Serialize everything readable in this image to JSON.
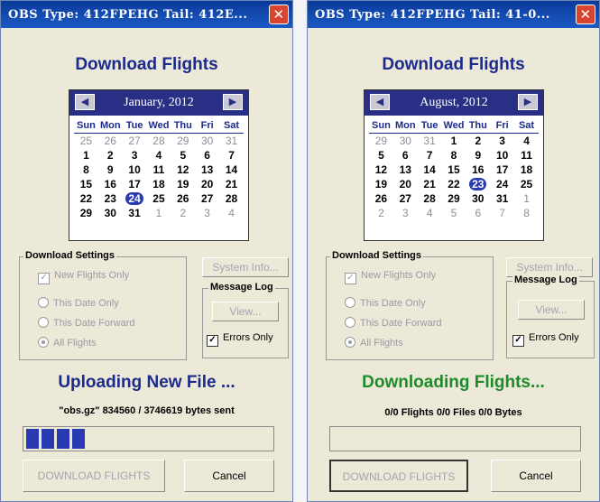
{
  "days_of_week": [
    "Sun",
    "Mon",
    "Tue",
    "Wed",
    "Thu",
    "Fri",
    "Sat"
  ],
  "left": {
    "title": "OBS    Type: 412FPEHG    Tail: 412E...",
    "heading": "Download Flights",
    "calendar": {
      "month_label": "January, 2012",
      "prev_icon": "◀",
      "next_icon": "▶",
      "weeks": [
        [
          "25",
          "26",
          "27",
          "28",
          "29",
          "30",
          "31"
        ],
        [
          "1",
          "2",
          "3",
          "4",
          "5",
          "6",
          "7"
        ],
        [
          "8",
          "9",
          "10",
          "11",
          "12",
          "13",
          "14"
        ],
        [
          "15",
          "16",
          "17",
          "18",
          "19",
          "20",
          "21"
        ],
        [
          "22",
          "23",
          "24",
          "25",
          "26",
          "27",
          "28"
        ],
        [
          "29",
          "30",
          "31",
          "1",
          "2",
          "3",
          "4"
        ]
      ]
    },
    "download_settings_label": "Download Settings",
    "new_flights_only": "New Flights Only",
    "this_date_only": "This Date Only",
    "this_date_forward": "This Date Forward",
    "all_flights": "All Flights",
    "system_info": "System Info...",
    "message_log_label": "Message Log",
    "view": "View...",
    "errors_only": "Errors Only",
    "status": "Uploading New File ...",
    "status_color": "#1b2a8c",
    "substatus": "\"obs.gz\"  834560 / 3746619 bytes sent",
    "progress_fraction": 0.22,
    "download_button": "DOWNLOAD FLIGHTS",
    "cancel_button": "Cancel"
  },
  "right": {
    "title": "OBS    Type: 412FPEHG    Tail: 41-0...",
    "heading": "Download Flights",
    "calendar": {
      "month_label": "August, 2012",
      "prev_icon": "◀",
      "next_icon": "▶",
      "weeks": [
        [
          "29",
          "30",
          "31",
          "1",
          "2",
          "3",
          "4"
        ],
        [
          "5",
          "6",
          "7",
          "8",
          "9",
          "10",
          "11"
        ],
        [
          "12",
          "13",
          "14",
          "15",
          "16",
          "17",
          "18"
        ],
        [
          "19",
          "20",
          "21",
          "22",
          "23",
          "24",
          "25"
        ],
        [
          "26",
          "27",
          "28",
          "29",
          "30",
          "31",
          "1"
        ],
        [
          "2",
          "3",
          "4",
          "5",
          "6",
          "7",
          "8"
        ]
      ]
    },
    "download_settings_label": "Download Settings",
    "new_flights_only": "New Flights Only",
    "this_date_only": "This Date Only",
    "this_date_forward": "This Date Forward",
    "all_flights": "All Flights",
    "system_info": "System Info...",
    "message_log_label": "Message Log",
    "view": "View...",
    "errors_only": "Errors Only",
    "status": "Downloading Flights...",
    "status_color": "#1e8a2a",
    "substatus": "0/0 Flights  0/0 Files  0/0 Bytes",
    "progress_fraction": 0.0,
    "download_button": "DOWNLOAD FLIGHTS",
    "cancel_button": "Cancel"
  }
}
